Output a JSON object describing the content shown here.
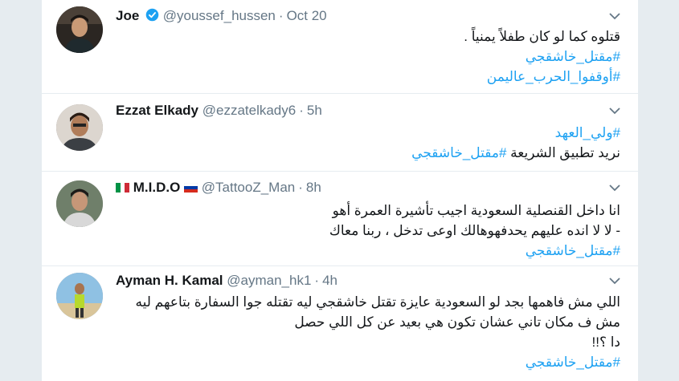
{
  "tweets": [
    {
      "name": "Joe",
      "verified": true,
      "handle": "@youssef_hussen",
      "time": "Oct 20",
      "lines": [
        "قتلوه كما لو كان طفلاً يمنياً ."
      ],
      "hashtags": [
        "#مقتل_خاشقجي",
        "#أوقفوا_الحرب_عاليمن"
      ]
    },
    {
      "name": "Ezzat Elkady",
      "verified": false,
      "handle": "@ezzatelkady6",
      "time": "5h",
      "pre_hashtag": "#ولي_العهد",
      "lines_with_tag": {
        "text": "نريد تطبيق الشريعة ",
        "tag": "#مقتل_خاشقجي"
      }
    },
    {
      "name": "M.I.D.O",
      "name_flags": [
        "italy-flag",
        "russia-flag"
      ],
      "verified": false,
      "handle": "@TattooZ_Man",
      "time": "8h",
      "lines": [
        "انا داخل القنصلية السعودية اجيب تأشيرة العمرة أهو",
        "- لا لا انده عليهم يحدفهوهالك اوعى تدخل ، ربنا معاك"
      ],
      "hashtags": [
        "#مقتل_خاشقجي"
      ]
    },
    {
      "name": "Ayman H. Kamal",
      "verified": false,
      "handle": "@ayman_hk1",
      "time": "4h",
      "lines": [
        "اللي مش فاهمها بجد لو السعودية عايزة تقتل خاشقجي ليه تقتله جوا السفارة بتاعهم ليه",
        "مش ف مكان تاني عشان تكون هي بعيد عن كل اللي حصل",
        "دا ؟!!"
      ],
      "hashtags": [
        "#مقتل_خاشقجي"
      ]
    }
  ],
  "separator": "·",
  "colors": {
    "link": "#1da1f2",
    "text": "#14171a",
    "muted": "#657786",
    "verified": "#1da1f2"
  }
}
